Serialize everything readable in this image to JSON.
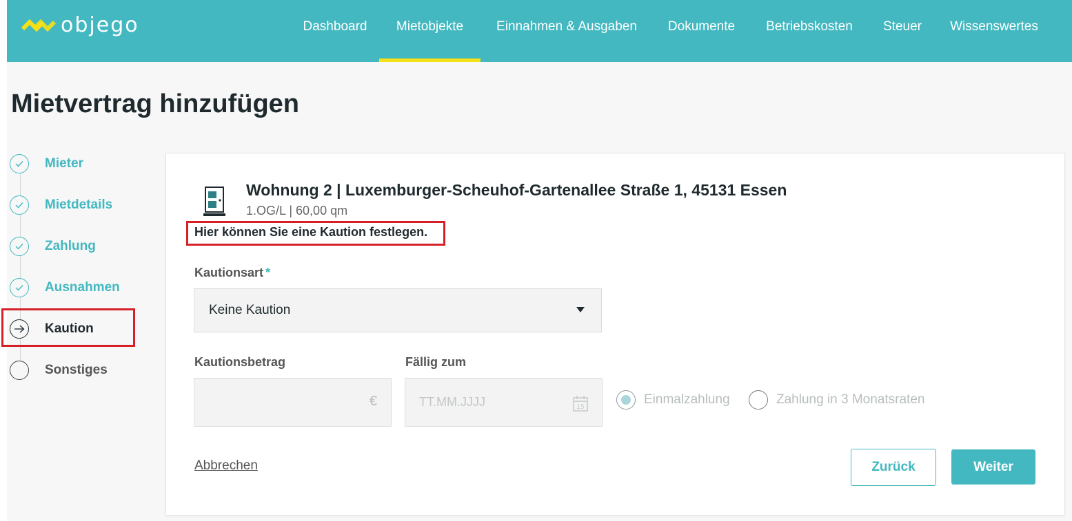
{
  "brand": {
    "name": "objego",
    "logo_icon": "objego-logo-icon",
    "accent": "#43b8c0",
    "highlight": "#f5e117"
  },
  "nav": {
    "items": [
      {
        "label": "Dashboard",
        "active": false
      },
      {
        "label": "Mietobjekte",
        "active": true
      },
      {
        "label": "Einnahmen & Ausgaben",
        "active": false
      },
      {
        "label": "Dokumente",
        "active": false
      },
      {
        "label": "Betriebskosten",
        "active": false
      },
      {
        "label": "Steuer",
        "active": false
      },
      {
        "label": "Wissenswertes",
        "active": false
      }
    ]
  },
  "page": {
    "title": "Mietvertrag hinzufügen"
  },
  "stepper": {
    "steps": [
      {
        "label": "Mieter",
        "status": "done",
        "icon": "check-icon"
      },
      {
        "label": "Mietdetails",
        "status": "done",
        "icon": "check-icon"
      },
      {
        "label": "Zahlung",
        "status": "done",
        "icon": "check-icon"
      },
      {
        "label": "Ausnahmen",
        "status": "done",
        "icon": "check-icon"
      },
      {
        "label": "Kaution",
        "status": "current",
        "icon": "arrow-right-icon"
      },
      {
        "label": "Sonstiges",
        "status": "upcoming",
        "icon": "empty-circle-icon"
      }
    ]
  },
  "property": {
    "icon": "door-icon",
    "title": "Wohnung 2 | Luxemburger-Scheuhof-Gartenallee Straße 1, 45131 Essen",
    "subtitle": "1.OG/L | 60,00 qm"
  },
  "hint": "Hier können Sie eine Kaution festlegen.",
  "form": {
    "deposit_type": {
      "label": "Kautionsart",
      "required_mark": "*",
      "value": "Keine Kaution"
    },
    "deposit_amount": {
      "label": "Kautionsbetrag",
      "value": "",
      "currency": "€"
    },
    "due_date": {
      "label": "Fällig zum",
      "placeholder": "TT.MM.JJJJ",
      "value": "",
      "calendar_day": "15"
    },
    "payment_options": [
      {
        "label": "Einmalzahlung",
        "checked": true
      },
      {
        "label": "Zahlung in 3 Monatsraten",
        "checked": false
      }
    ]
  },
  "actions": {
    "cancel": "Abbrechen",
    "back": "Zurück",
    "next": "Weiter"
  }
}
